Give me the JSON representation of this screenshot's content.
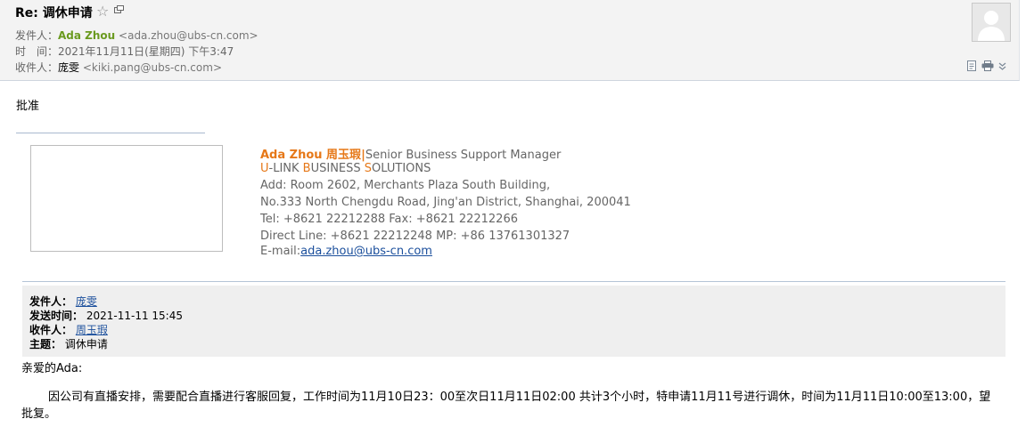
{
  "header": {
    "subject": "Re: 调休申请",
    "from_label": "发件人：",
    "from_name": "Ada Zhou",
    "from_email": "<ada.zhou@ubs-cn.com>",
    "time_label": "时　间：",
    "time_value": "2021年11月11日(星期四) 下午3:47",
    "to_label": "收件人：",
    "to_name": "庞雯",
    "to_email": "<kiki.pang@ubs-cn.com>"
  },
  "reply": {
    "text": "批准"
  },
  "signature": {
    "name": "Ada Zhou 周玉瑕",
    "sep": "|",
    "title": "Senior Business Support Manager",
    "company_u": "U",
    "company_link": "-LINK ",
    "company_b": "B",
    "company_usiness": "USINESS ",
    "company_s": "S",
    "company_olutions": "OLUTIONS",
    "addr1": "Add: Room 2602, Merchants Plaza South Building,",
    "addr2": "No.333 North Chengdu Road, Jing'an District, Shanghai, 200041",
    "tel": "Tel: +8621 22212288  Fax: +8621 22212266",
    "direct": "Direct Line: +8621 22212248   MP: +86 13761301327",
    "email_label": "E-mail:",
    "email": "ada.zhou@ubs-cn.com"
  },
  "original": {
    "from_label": "发件人：",
    "from_value": "庞雯",
    "sent_label": "发送时间：",
    "sent_value": "2021-11-11 15:45",
    "to_label": "收件人：",
    "to_value": "周玉瑕",
    "subject_label": "主题：",
    "subject_value": "调休申请"
  },
  "message": {
    "greeting": "亲爱的Ada:",
    "paragraph": "因公司有直播安排，需要配合直播进行客服回复，工作时间为11月10日23：00至次日11月11日02:00 共计3个小时，特申请11月11号进行调休，时间为11月11日10:00至13:00，望批复。"
  },
  "icons": {
    "star": "star-icon",
    "popout": "popout-window-icon",
    "avatar": "avatar",
    "toolbar": [
      "note-icon",
      "print-icon",
      "more-chevron-icon"
    ]
  }
}
